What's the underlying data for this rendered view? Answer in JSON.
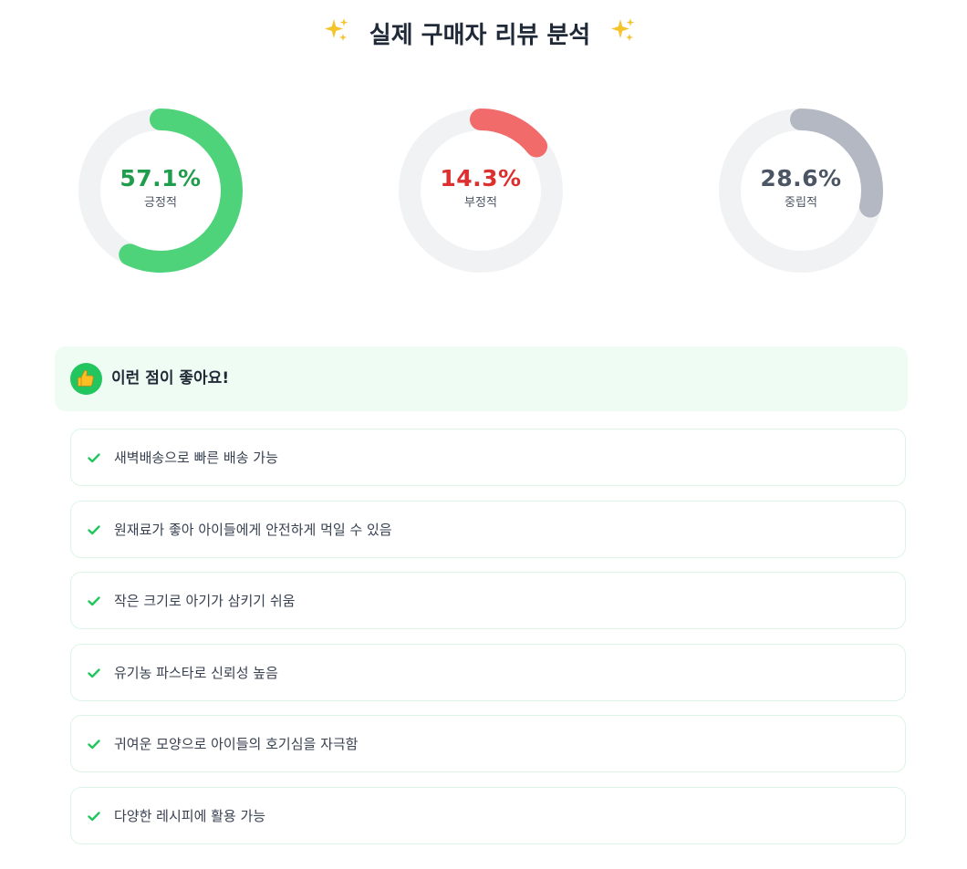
{
  "header": {
    "title": "실제 구매자 리뷰 분석",
    "left_icon": "sparkles-icon",
    "right_icon": "sparkles-icon",
    "icon_color": "#f5c42c"
  },
  "sentiment": {
    "track_color": "#f1f2f4",
    "items": [
      {
        "percent_text": "57.1%",
        "value": 57.1,
        "label": "긍정적",
        "ring_color": "#4ed37a",
        "text_color": "#1f9d4c"
      },
      {
        "percent_text": "14.3%",
        "value": 14.3,
        "label": "부정적",
        "ring_color": "#f16b6b",
        "text_color": "#dc2f2f"
      },
      {
        "percent_text": "28.6%",
        "value": 28.6,
        "label": "중립적",
        "ring_color": "#b4b8c2",
        "text_color": "#4b5563"
      }
    ]
  },
  "pros": {
    "title": "이런 점이 좋아요!",
    "icon": "thumbs-up-icon",
    "accent_color": "#22c55e",
    "items": [
      "새벽배송으로 빠른 배송 가능",
      "원재료가 좋아 아이들에게 안전하게 먹일 수 있음",
      "작은 크기로 아기가 삼키기 쉬움",
      "유기농 파스타로 신뢰성 높음",
      "귀여운 모양으로 아이들의 호기심을 자극함",
      "다양한 레시피에 활용 가능"
    ]
  }
}
